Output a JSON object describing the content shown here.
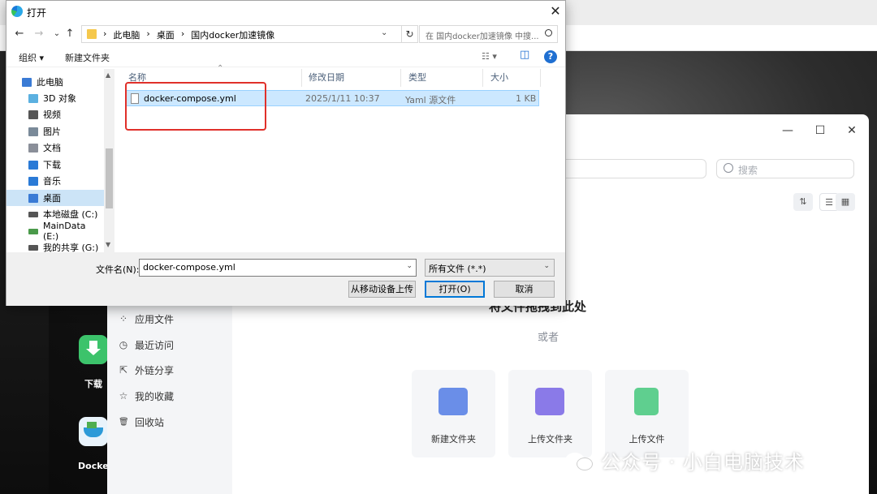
{
  "dialog": {
    "title": "打开",
    "close_glyph": "✕",
    "nav": {
      "back": "←",
      "forward": "→",
      "recent": "⌄",
      "up": "↑"
    },
    "address": {
      "crumbs": [
        "此电脑",
        "桌面",
        "国内docker加速镜像"
      ],
      "separator": "›",
      "dropdown": "⌄",
      "refresh": "↻"
    },
    "search_placeholder": "在 国内docker加速镜像 中搜...",
    "toolbar": {
      "organize": "组织 ▾",
      "new_folder": "新建文件夹",
      "view_glyph": "☷ ▾",
      "pane_glyph": "◫",
      "help": "?"
    },
    "tree": [
      {
        "label": "此电脑",
        "icon": "computer-icon",
        "color": "#3a7bd5"
      },
      {
        "label": "3D 对象",
        "icon": "cube-icon",
        "color": "#5bb0e0"
      },
      {
        "label": "视频",
        "icon": "video-icon",
        "color": "#555555"
      },
      {
        "label": "图片",
        "icon": "image-icon",
        "color": "#7a8a99"
      },
      {
        "label": "文档",
        "icon": "document-icon",
        "color": "#8a8f99"
      },
      {
        "label": "下载",
        "icon": "download-icon",
        "color": "#2a7ad6"
      },
      {
        "label": "音乐",
        "icon": "music-icon",
        "color": "#2a7ad6"
      },
      {
        "label": "桌面",
        "icon": "desktop-icon",
        "color": "#3a7bd5",
        "selected": true
      },
      {
        "label": "本地磁盘 (C:)",
        "icon": "drive-icon",
        "color": "#555555"
      },
      {
        "label": "MainData (E:)",
        "icon": "drive-icon",
        "color": "#4a9a4a"
      },
      {
        "label": "我的共享 (G:)",
        "icon": "network-drive-icon",
        "color": "#555555"
      }
    ],
    "columns": [
      "名称",
      "修改日期",
      "类型",
      "大小"
    ],
    "sort_glyph": "⌃",
    "files": [
      {
        "name": "docker-compose.yml",
        "modified": "2025/1/11 10:37",
        "type": "Yaml 源文件",
        "size": "1 KB"
      }
    ],
    "filename_label": "文件名(N):",
    "filename_value": "docker-compose.yml",
    "filetype_value": "所有文件 (*.*)",
    "dropdown_glyph": "⌄",
    "buttons": {
      "mobile_upload": "从移动设备上传",
      "open": "打开(O)",
      "cancel": "取消"
    }
  },
  "background": {
    "desktop_apps": [
      {
        "label": "下载",
        "icon": "download-app-icon",
        "color": "#3cc36b"
      },
      {
        "label": "Docker",
        "icon": "docker-app-icon",
        "color": "#e9f3fb"
      }
    ],
    "file_manager": {
      "window_controls": [
        "—",
        "☐",
        "✕"
      ],
      "search_placeholder": "搜索",
      "sort_glyph": "⇅",
      "view_glyphs": [
        "☰",
        "▦"
      ],
      "nav": [
        {
          "label": "应用文件",
          "icon": "apps-icon",
          "glyph": "⁘"
        },
        {
          "label": "最近访问",
          "icon": "clock-icon",
          "glyph": "◷"
        },
        {
          "label": "外链分享",
          "icon": "share-icon",
          "glyph": "⇱"
        },
        {
          "label": "我的收藏",
          "icon": "star-icon",
          "glyph": "☆"
        },
        {
          "label": "回收站",
          "icon": "trash-icon",
          "glyph": "🗑"
        }
      ],
      "drop_title": "将文件拖拽到此处",
      "or_text": "或者",
      "cards": [
        {
          "label": "新建文件夹",
          "icon": "new-folder-icon",
          "color": "#6a8ee8"
        },
        {
          "label": "上传文件夹",
          "icon": "upload-folder-icon",
          "color": "#8a7ae8"
        },
        {
          "label": "上传文件",
          "icon": "upload-file-icon",
          "color": "#5fcf8f"
        }
      ]
    },
    "watermark": "公众号 · 小白电脑技术"
  },
  "colors": {
    "accent": "#0078d7",
    "selection": "#cce8ff",
    "highlight_box": "#e0302a"
  }
}
